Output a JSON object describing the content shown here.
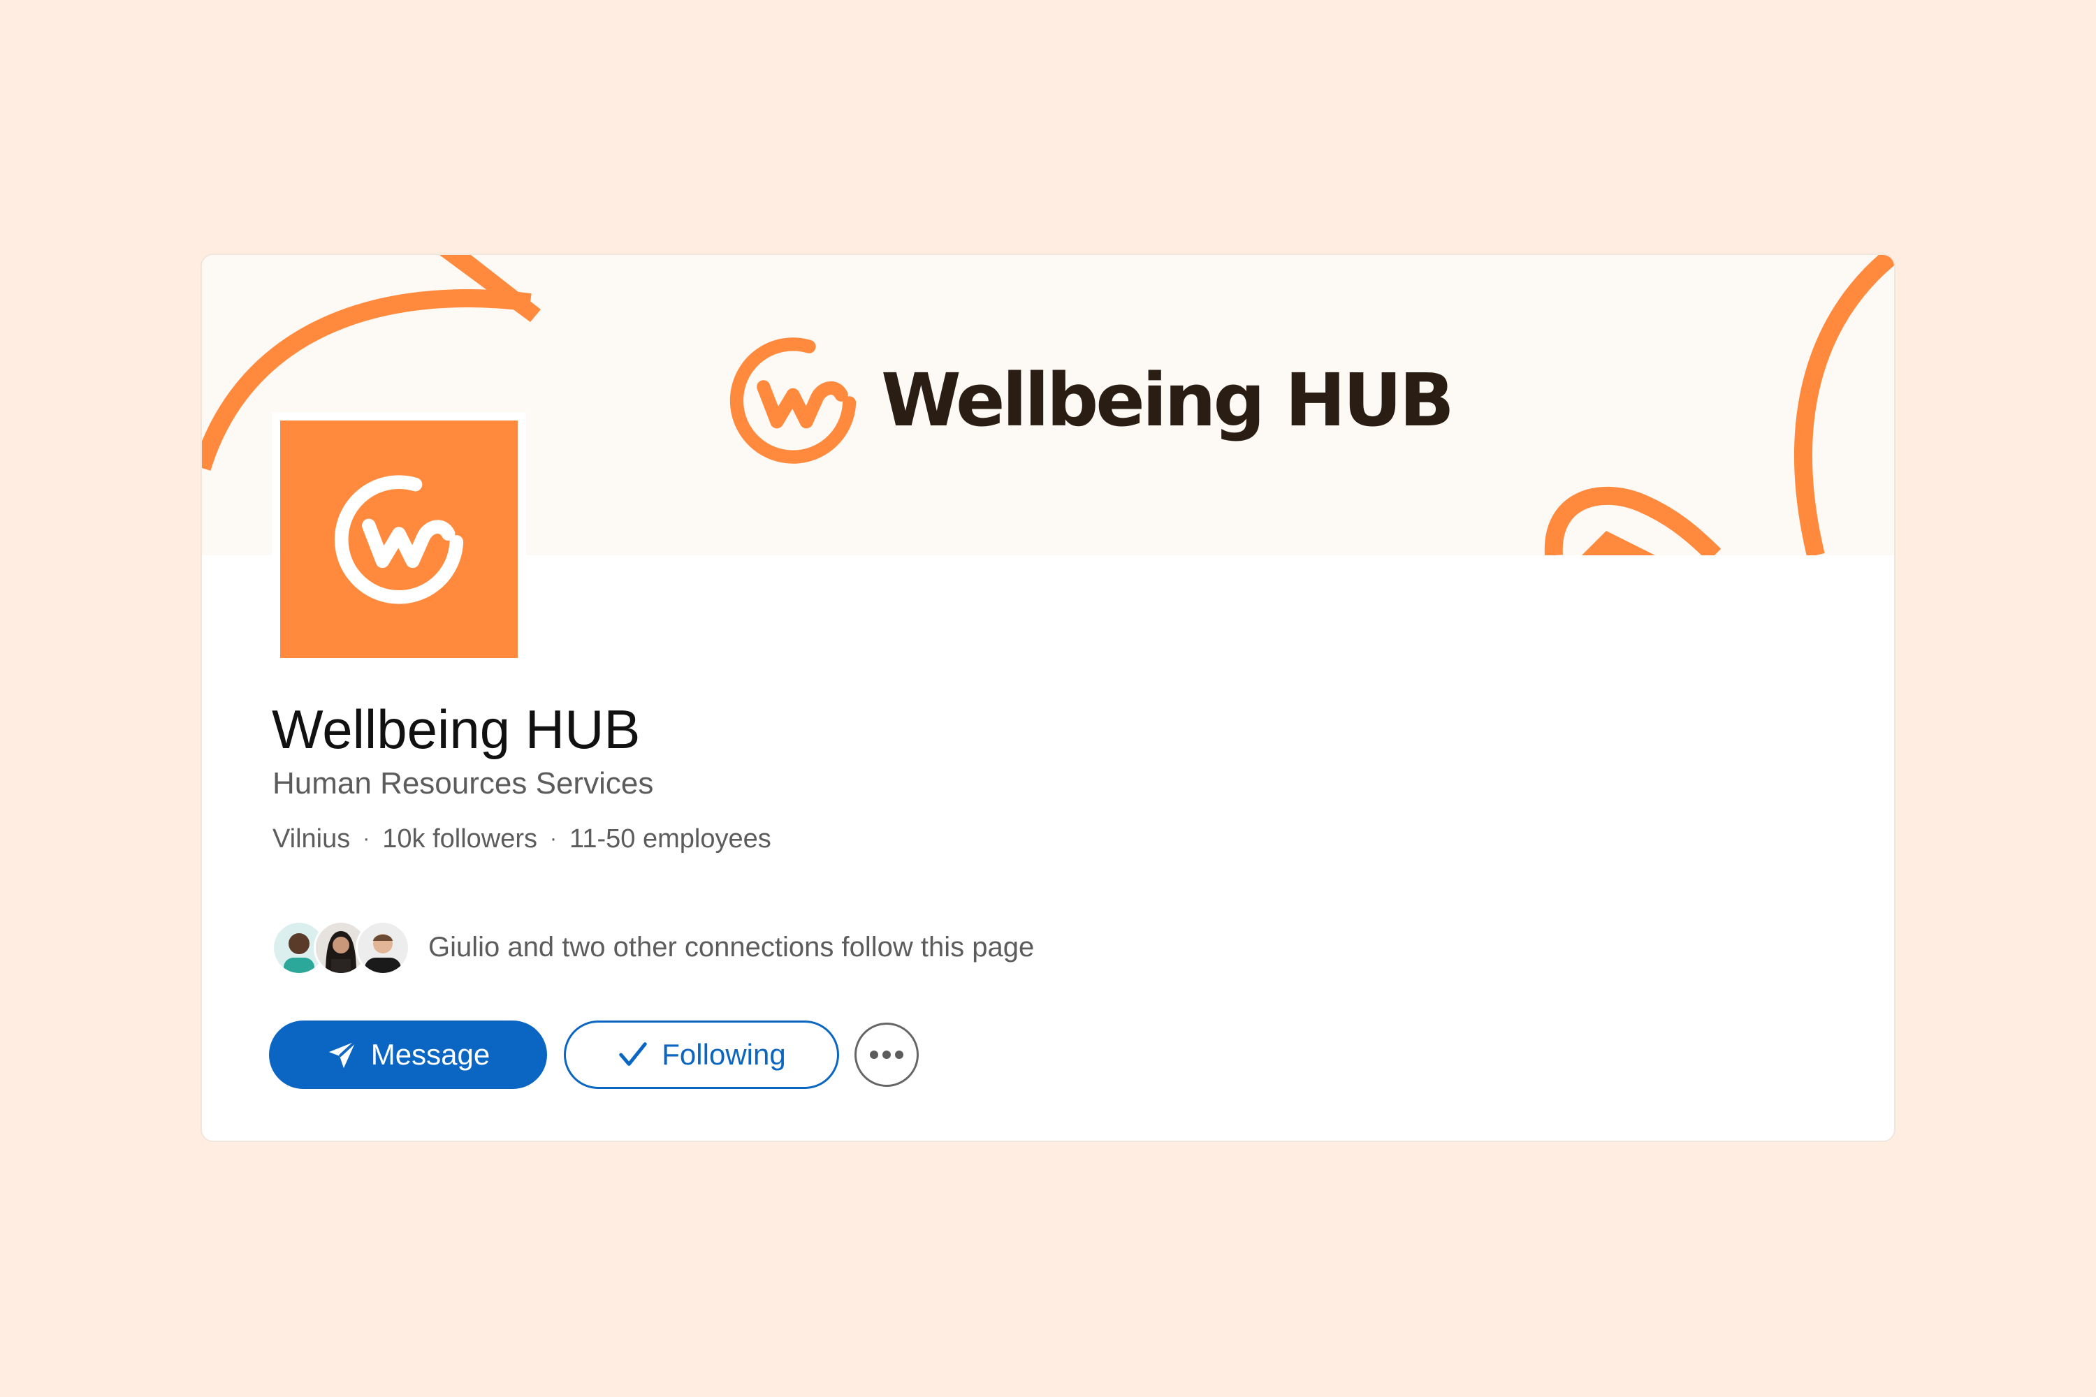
{
  "colors": {
    "page_background": "#FEEDE0",
    "banner_background": "#FDF9F5",
    "brand_orange": "#FF8A3D",
    "brand_dark": "#2A1E14",
    "primary_blue": "#0A66C2"
  },
  "banner": {
    "logo_icon": "wellbeing-hub-logo-mark",
    "wordmark": "Wellbeing HUB"
  },
  "profile": {
    "logo_icon": "wellbeing-hub-logo-mark",
    "name": "Wellbeing HUB",
    "industry": "Human Resources Services",
    "location": "Vilnius",
    "separator": "·",
    "followers": "10k followers",
    "employees": "11-50 employees"
  },
  "connections": {
    "avatars": [
      "connection-avatar-1",
      "connection-avatar-2",
      "connection-avatar-3"
    ],
    "text": "Giulio and two other connections follow this page"
  },
  "actions": {
    "message_label": "Message",
    "message_icon": "send-icon",
    "following_label": "Following",
    "following_icon": "checkmark-icon",
    "more_icon": "more-icon"
  }
}
